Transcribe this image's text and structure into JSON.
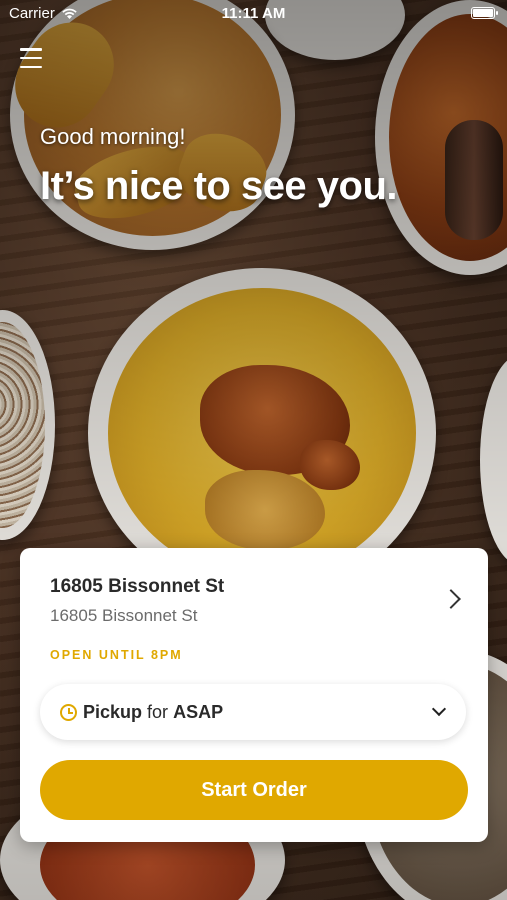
{
  "status_bar": {
    "carrier": "Carrier",
    "time": "11:11 AM",
    "wifi_icon": "wifi-icon",
    "battery_icon": "battery-icon"
  },
  "header": {
    "menu_icon": "hamburger-menu-icon",
    "greeting": "Good morning!",
    "headline": "It’s nice to see you."
  },
  "location_card": {
    "name": "16805 Bissonnet St",
    "address": "16805 Bissonnet St",
    "hours": "OPEN UNTIL 8PM",
    "chevron_icon": "chevron-right-icon",
    "order_mode": {
      "icon": "clock-icon",
      "mode": "Pickup",
      "connector": "for",
      "time": "ASAP",
      "chevron_icon": "chevron-down-icon"
    },
    "start_order_label": "Start Order"
  },
  "colors": {
    "accent": "#e0a800",
    "text_primary": "#2a2a2a",
    "text_secondary": "#6b6b6b"
  }
}
